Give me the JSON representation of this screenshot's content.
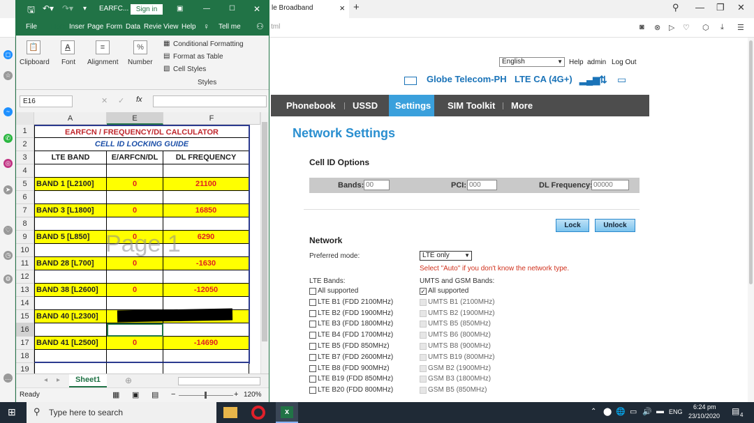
{
  "browser": {
    "tab_title": "le Broadband",
    "url_fragment": "tml",
    "new_tab": "+"
  },
  "router": {
    "language": "English",
    "help": "Help",
    "user": "admin",
    "logout": "Log Out",
    "operator": "Globe Telecom-PH",
    "network_type": "LTE CA (4G+)",
    "nav": [
      "Phonebook",
      "USSD",
      "Settings",
      "SIM Toolkit",
      "More"
    ],
    "active_nav": "Settings",
    "page_title": "Network Settings",
    "cell_section": "Cell ID Options",
    "bands_label": "Bands:",
    "bands_placeholder": "00",
    "pci_label": "PCI:",
    "pci_placeholder": "000",
    "dlfreq_label": "DL Frequency:",
    "dlfreq_placeholder": "00000",
    "lock_btn": "Lock",
    "unlock_btn": "Unlock",
    "network_section": "Network",
    "pref_label": "Preferred mode:",
    "pref_value": "LTE only",
    "warning": "Select \"Auto\" if you don't know the network type.",
    "lte_bands_label": "LTE Bands:",
    "umts_label": "UMTS and GSM Bands:",
    "lte_bands": [
      {
        "label": "All supported",
        "checked": false
      },
      {
        "label": "LTE B1 (FDD 2100MHz)",
        "checked": false
      },
      {
        "label": "LTE B2 (FDD 1900MHz)",
        "checked": false
      },
      {
        "label": "LTE B3 (FDD 1800MHz)",
        "checked": false
      },
      {
        "label": "LTE B4 (FDD 1700MHz)",
        "checked": false
      },
      {
        "label": "LTE B5 (FDD 850MHz)",
        "checked": false
      },
      {
        "label": "LTE B7 (FDD 2600MHz)",
        "checked": false
      },
      {
        "label": "LTE B8 (FDD 900MHz)",
        "checked": false
      },
      {
        "label": "LTE B19 (FDD 850MHz)",
        "checked": false
      },
      {
        "label": "LTE B20 (FDD 800MHz)",
        "checked": false
      }
    ],
    "umts_bands": [
      {
        "label": "All supported",
        "checked": true
      },
      {
        "label": "UMTS B1 (2100MHz)",
        "checked": false
      },
      {
        "label": "UMTS B2 (1900MHz)",
        "checked": false
      },
      {
        "label": "UMTS B5 (850MHz)",
        "checked": false
      },
      {
        "label": "UMTS B6 (800MHz)",
        "checked": false
      },
      {
        "label": "UMTS B8 (900MHz)",
        "checked": false
      },
      {
        "label": "UMTS B19 (800MHz)",
        "checked": false
      },
      {
        "label": "GSM B2 (1900MHz)",
        "checked": false
      },
      {
        "label": "GSM B3 (1800MHz)",
        "checked": false
      },
      {
        "label": "GSM B5 (850MHz)",
        "checked": false
      }
    ]
  },
  "excel": {
    "title": "EARFC...",
    "sign_in": "Sign in",
    "menu": [
      "File",
      "Hom",
      "Inser",
      "Page",
      "Form",
      "Data",
      "Revie",
      "View",
      "Help",
      "Tell me"
    ],
    "ribbon": {
      "clipboard": "Clipboard",
      "font": "Font",
      "alignment": "Alignment",
      "number": "Number",
      "conditional": "Conditional Formatting",
      "format_table": "Format as Table",
      "cell_styles": "Cell Styles",
      "styles": "Styles"
    },
    "name_box": "E16",
    "fx": "fx",
    "columns": [
      "A",
      "E",
      "F"
    ],
    "rows": [
      "1",
      "2",
      "3",
      "4",
      "5",
      "6",
      "7",
      "8",
      "9",
      "10",
      "11",
      "12",
      "13",
      "14",
      "15",
      "16",
      "17",
      "18",
      "19"
    ],
    "title_row": "EARFCN / FREQUENCY/DL CALCULATOR",
    "subtitle_row": "CELL ID LOCKING GUIDE",
    "headers": [
      "LTE BAND",
      "E/ARFCN/DL",
      "DL FREQUENCY"
    ],
    "data_rows": [
      {
        "band": "BAND 1 [L2100]",
        "earfcn": "0",
        "freq": "21100"
      },
      {
        "band": "BAND 3 [L1800]",
        "earfcn": "0",
        "freq": "16850"
      },
      {
        "band": "BAND 5 [L850]",
        "earfcn": "0",
        "freq": "6290"
      },
      {
        "band": "BAND 28 [L700]",
        "earfcn": "0",
        "freq": "-1630"
      },
      {
        "band": "BAND 38 [L2600]",
        "earfcn": "0",
        "freq": "-12050"
      },
      {
        "band": "BAND 40 [L2300]",
        "earfcn": "",
        "freq": ""
      },
      {
        "band": "BAND 41 [L2500]",
        "earfcn": "0",
        "freq": "-14690"
      }
    ],
    "watermark": "Page 1",
    "sheet_tab": "Sheet1",
    "status_ready": "Ready",
    "zoom": "120%"
  },
  "taskbar": {
    "search_placeholder": "Type here to search",
    "lang": "ENG",
    "time": "6:24 pm",
    "date": "23/10/2020",
    "notif_count": "4"
  }
}
